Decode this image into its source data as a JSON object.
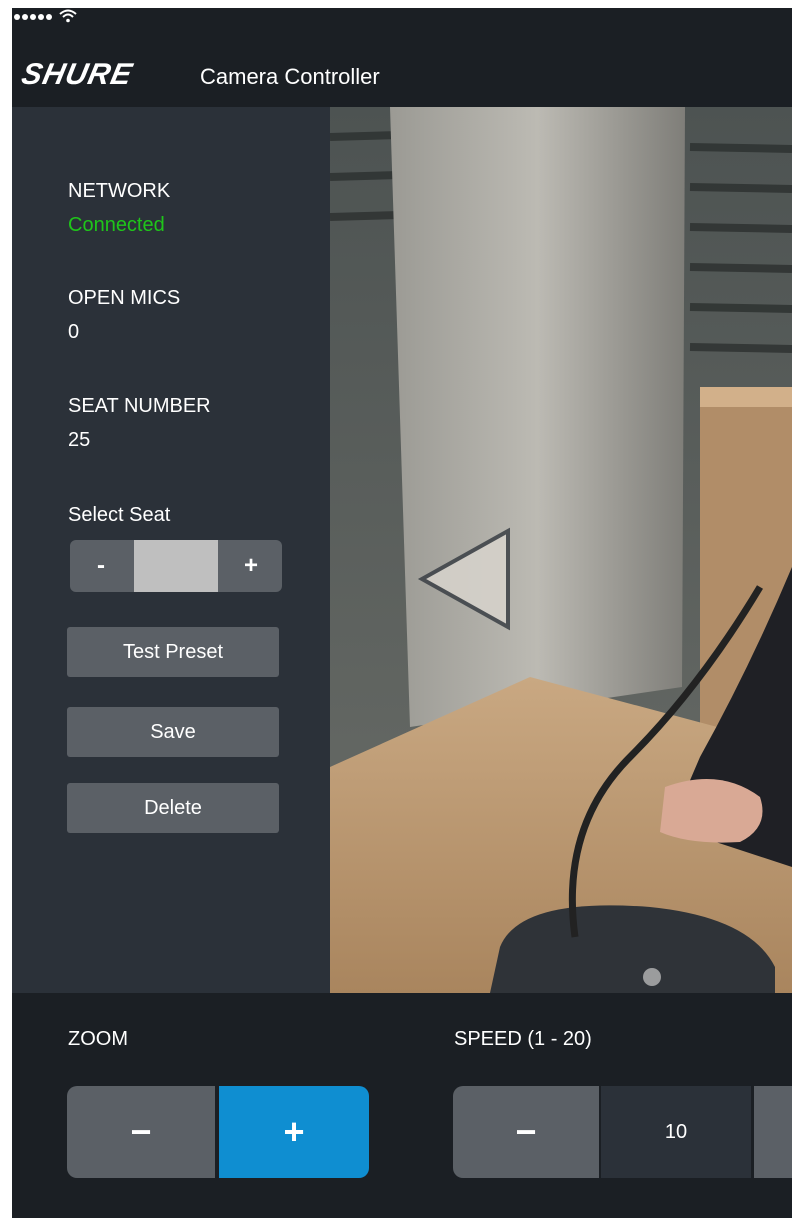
{
  "app": {
    "brand": "SHURE",
    "title": "Camera Controller"
  },
  "status_bar": {
    "signal_icon": "signal-dots-icon",
    "wifi_icon": "wifi-icon"
  },
  "sidebar": {
    "network_label": "NETWORK",
    "network_value": "Connected",
    "open_mics_label": "OPEN MICS",
    "open_mics_value": "0",
    "seat_number_label": "SEAT NUMBER",
    "seat_number_value": "25",
    "select_seat_label": "Select Seat",
    "select_seat_value": "",
    "minus_label": "-",
    "plus_label": "+",
    "test_preset_label": "Test Preset",
    "save_label": "Save",
    "delete_label": "Delete"
  },
  "camera": {
    "pan_left_icon": "triangle-left-icon"
  },
  "controls": {
    "zoom_label": "ZOOM",
    "zoom_minus": "−",
    "zoom_plus": "+",
    "speed_label": "SPEED (1 - 20)",
    "speed_minus": "−",
    "speed_value": "10"
  },
  "colors": {
    "connected": "#1fc51a",
    "accent": "#0f8ed1",
    "panel": "#2b3139",
    "button": "#5b6066",
    "background": "#1b1f24"
  }
}
